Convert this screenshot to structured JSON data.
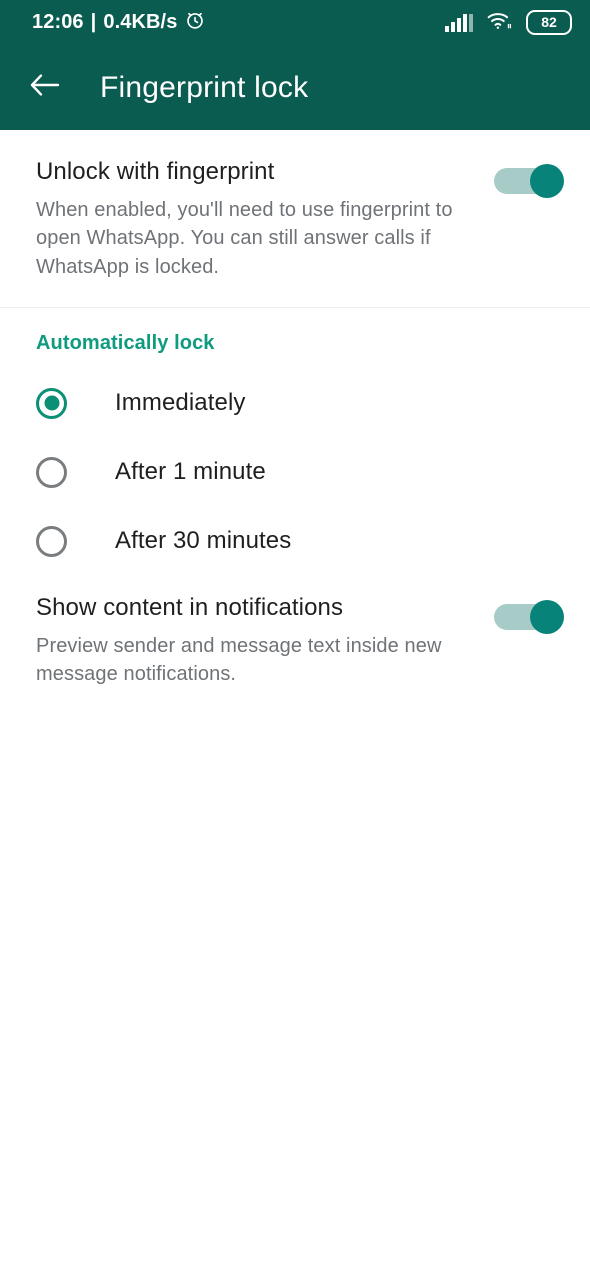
{
  "status_bar": {
    "time": "12:06",
    "separator": "|",
    "network_speed": "0.4KB/s",
    "alarm_icon": "alarm-clock-icon",
    "signal_icon": "signal-bars-icon",
    "wifi_icon": "wifi-icon",
    "battery_level": "82"
  },
  "app_bar": {
    "back_icon": "back-arrow-icon",
    "title": "Fingerprint lock"
  },
  "fingerprint_setting": {
    "title": "Unlock with fingerprint",
    "description": "When enabled, you'll need to use fingerprint to open WhatsApp. You can still answer calls if WhatsApp is locked.",
    "toggle_state": "on"
  },
  "auto_lock_section": {
    "header": "Automatically lock",
    "options": [
      {
        "label": "Immediately",
        "selected": true
      },
      {
        "label": "After 1 minute",
        "selected": false
      },
      {
        "label": "After 30 minutes",
        "selected": false
      }
    ]
  },
  "notifications_setting": {
    "title": "Show content in notifications",
    "description": "Preview sender and message text inside new message notifications.",
    "toggle_state": "on"
  },
  "colors": {
    "app_bar_teal": "#0a5b50",
    "accent_teal": "#0f9b7e",
    "toggle_thumb": "#07837a",
    "toggle_track": "#a7ccc7",
    "radio_selected": "#0b8f76",
    "radio_unselected": "#797d80",
    "title_text": "#1f1f1f",
    "description_text": "#6f7377",
    "background": "#ffffff"
  }
}
